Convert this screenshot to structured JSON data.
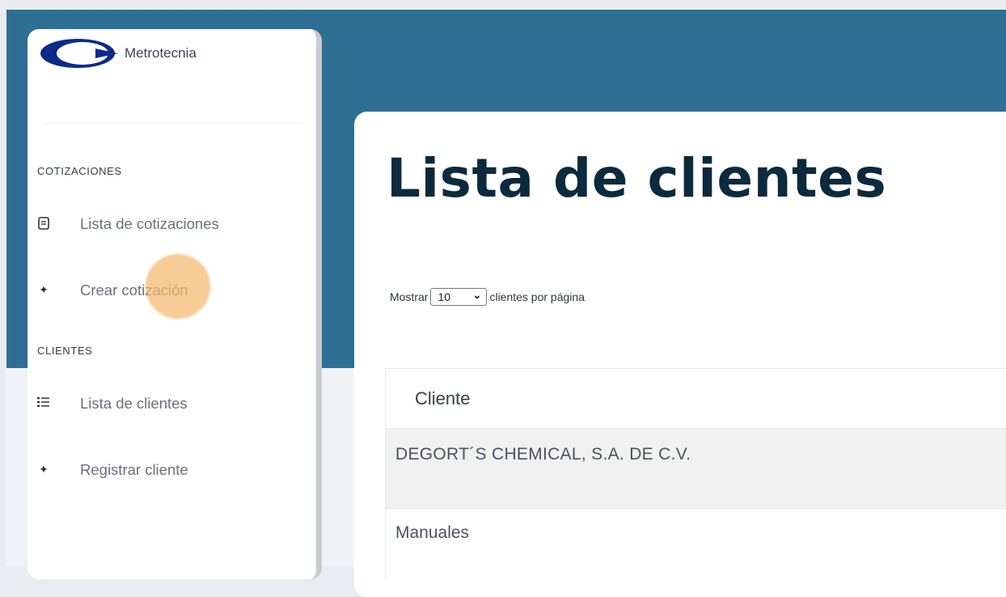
{
  "brand": {
    "name": "Metrotecnia"
  },
  "sidebar": {
    "sections": [
      {
        "title": "COTIZACIONES",
        "items": [
          {
            "label": "Lista de cotizaciones",
            "icon": "list-document-icon"
          },
          {
            "label": "Crear cotización",
            "icon": "plus-icon"
          }
        ]
      },
      {
        "title": "CLIENTES",
        "items": [
          {
            "label": "Lista de clientes",
            "icon": "bullet-list-icon"
          },
          {
            "label": "Registrar cliente",
            "icon": "plus-icon"
          }
        ]
      }
    ]
  },
  "main": {
    "title": "Lista de clientes",
    "length_menu": {
      "prefix": "Mostrar",
      "value": "10",
      "suffix": "clientes por página"
    },
    "table": {
      "columns": [
        "Cliente"
      ],
      "rows": [
        [
          "DEGORT´S CHEMICAL, S.A. DE C.V."
        ],
        [
          "Manuales"
        ]
      ]
    }
  },
  "colors": {
    "header_blue": "#2e6f93",
    "title_dark": "#0c2a3d",
    "cursor_highlight": "#f5b96e"
  }
}
